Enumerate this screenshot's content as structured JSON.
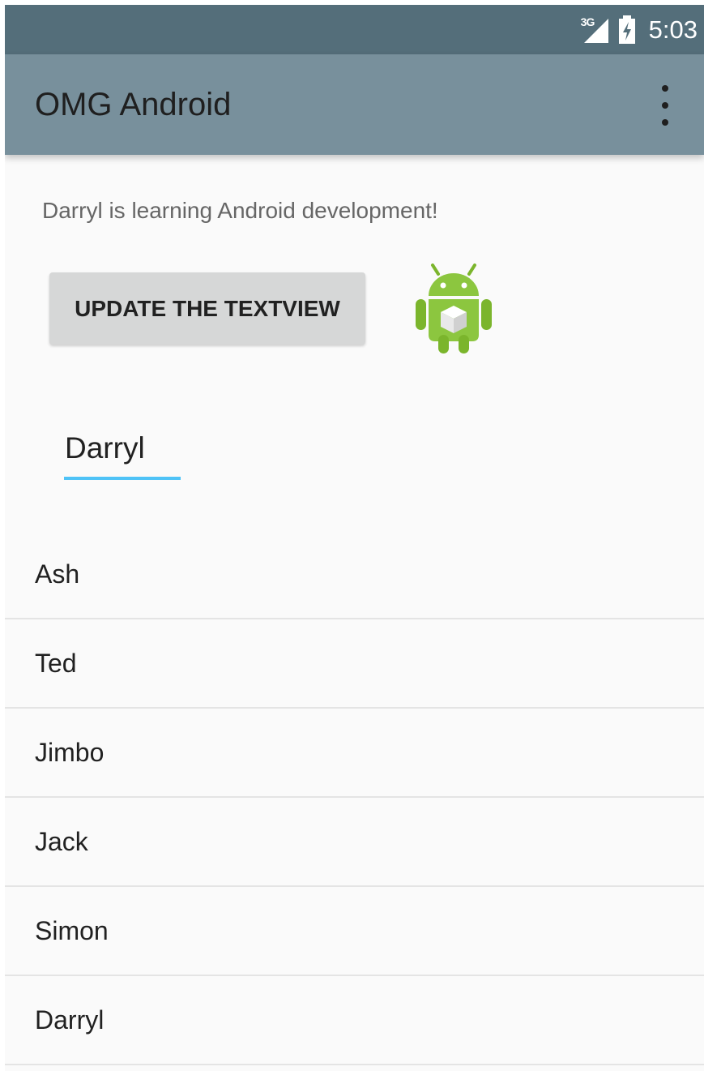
{
  "status_bar": {
    "network": "3G",
    "time": "5:03",
    "signal_icon": "signal-icon",
    "battery_icon": "battery-charging-icon"
  },
  "app_bar": {
    "title": "OMG Android",
    "menu_icon": "overflow-menu-icon"
  },
  "main": {
    "text": "Darryl is learning Android development!",
    "button_label": "UPDATE THE TEXTVIEW",
    "logo_icon": "android-logo-icon",
    "input_value": "Darryl"
  },
  "names": [
    "Ash",
    "Ted",
    "Jimbo",
    "Jack",
    "Simon",
    "Darryl"
  ],
  "colors": {
    "status_bar": "#546e7a",
    "app_bar": "#78909c",
    "accent": "#4fc3f7",
    "background": "#fafafa"
  }
}
